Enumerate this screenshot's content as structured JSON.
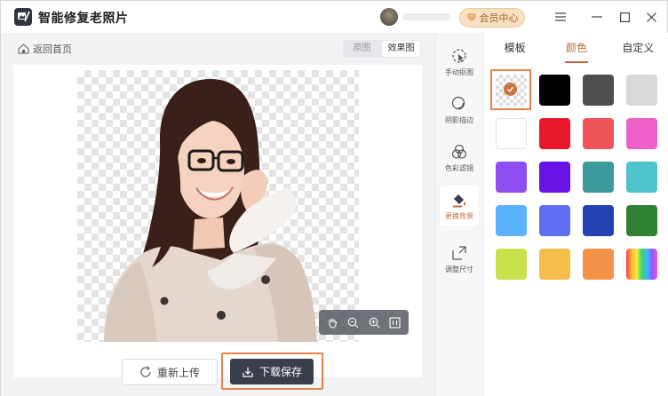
{
  "app": {
    "title": "智能修复老照片"
  },
  "header": {
    "vip_label": "会员中心"
  },
  "content": {
    "back_label": "返回首页",
    "toggle": {
      "original": "原图",
      "result": "效果图"
    },
    "reupload_label": "重新上传",
    "download_label": "下载保存"
  },
  "tools": [
    {
      "label": "手动抠图",
      "icon": "cursor-select-icon"
    },
    {
      "label": "阴影描边",
      "icon": "shadow-outline-icon"
    },
    {
      "label": "色彩滤镜",
      "icon": "color-filter-icon"
    },
    {
      "label": "更换背景",
      "icon": "paint-bucket-icon"
    },
    {
      "label": "调整尺寸",
      "icon": "resize-icon"
    }
  ],
  "panel": {
    "tabs": [
      "模板",
      "颜色",
      "自定义"
    ],
    "active_tab": 1,
    "swatches": [
      "transparent",
      "#000000",
      "#4f4f4f",
      "#d9d9d9",
      "#ffffff",
      "#e8182a",
      "#ee5458",
      "#ee5fc9",
      "#8f4ff0",
      "#6a13e6",
      "#3c9a9b",
      "#4ec3cc",
      "#59b2fb",
      "#5f6ff3",
      "#2341b0",
      "#2e8232",
      "#c7e24c",
      "#f5bd4a",
      "#f4924a",
      "rainbow"
    ],
    "selected_swatch": 0
  },
  "colors": {
    "accent": "#c76a3a",
    "highlight_border": "#ec7f4c",
    "primary_button": "#3b3f4d"
  }
}
